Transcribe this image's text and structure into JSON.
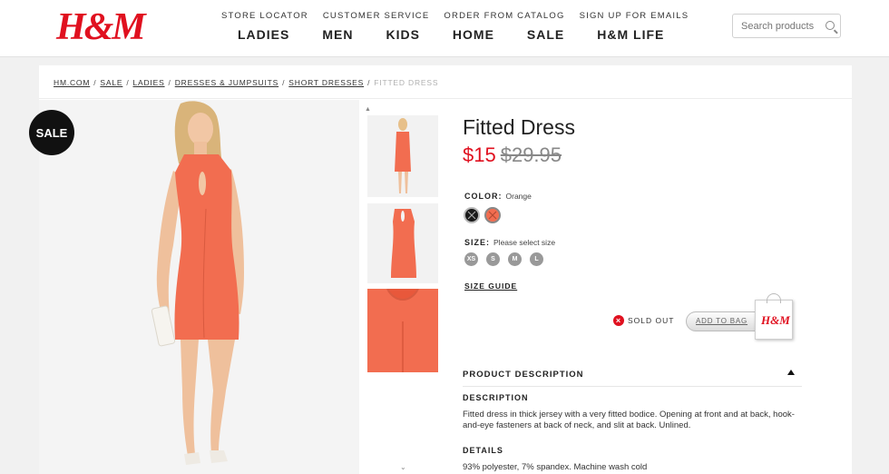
{
  "header": {
    "logo": "H&M",
    "utility": [
      "STORE LOCATOR",
      "CUSTOMER SERVICE",
      "ORDER FROM CATALOG",
      "SIGN UP FOR EMAILS"
    ],
    "nav": [
      "LADIES",
      "MEN",
      "KIDS",
      "HOME",
      "SALE",
      "H&M LIFE"
    ],
    "search_placeholder": "Search products"
  },
  "breadcrumb": {
    "items": [
      "HM.COM",
      "SALE",
      "LADIES",
      "DRESSES & JUMPSUITS",
      "SHORT DRESSES"
    ],
    "current": "FITTED DRESS"
  },
  "badge": "SALE",
  "product": {
    "title": "Fitted Dress",
    "price_now": "$15",
    "price_was": "$29.95",
    "color_label": "COLOR:",
    "color_value": "Orange",
    "size_label": "SIZE:",
    "size_value": "Please select size",
    "sizes": [
      "XS",
      "S",
      "M",
      "L"
    ],
    "size_guide": "SIZE GUIDE",
    "sold_out": "SOLD OUT",
    "add_to_bag": "ADD TO BAG",
    "bag_logo": "H&M"
  },
  "description": {
    "heading": "PRODUCT DESCRIPTION",
    "sub1": "DESCRIPTION",
    "text1": "Fitted dress in thick jersey with a very fitted bodice. Opening at front and at back, hook-and-eye fasteners at back of neck, and slit at back. Unlined.",
    "sub2": "DETAILS",
    "text2": "93% polyester, 7% spandex. Machine wash cold"
  },
  "colors": {
    "brand_red": "#e0101f",
    "dress_orange": "#f26d50",
    "swatch_black": "#1a1a1a"
  },
  "icons": {
    "collapse": "caret-up-icon",
    "sold_out": "x-circle-icon",
    "search": "magnifier-icon"
  }
}
